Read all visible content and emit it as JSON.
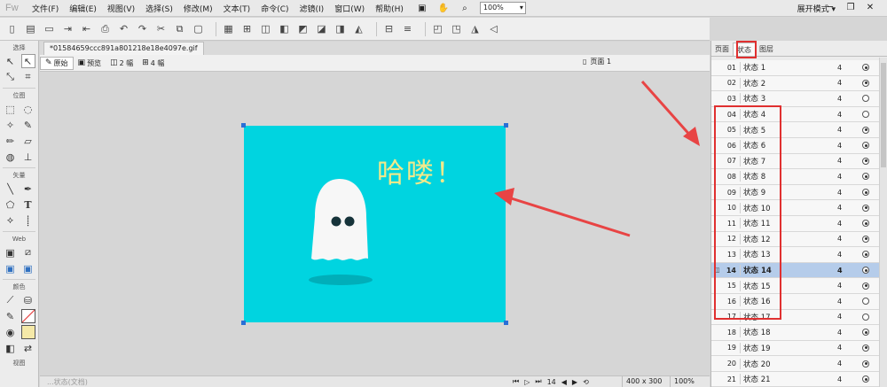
{
  "app": {
    "logo": "Fw"
  },
  "menu": [
    "文件(F)",
    "编辑(E)",
    "视图(V)",
    "选择(S)",
    "修改(M)",
    "文本(T)",
    "命令(C)",
    "滤镜(I)",
    "窗口(W)",
    "帮助(H)"
  ],
  "menubar": {
    "zoom_value": "100%",
    "workspace_label": "展开模式 ▾"
  },
  "tool_sections": [
    "选择",
    "位图",
    "矢量",
    "Web",
    "颜色",
    "视图"
  ],
  "document": {
    "tab_title": "*01584659ccc891a801218e18e4097e.gif",
    "view_buttons": [
      "原始",
      "预览",
      "2 幅",
      "4 幅"
    ],
    "page_label": "页面 1"
  },
  "canvas": {
    "text": "哈喽！",
    "bg_color": "#00d4e0",
    "text_color": "#f2e98a"
  },
  "statusbar": {
    "left_text": "...状态(文档)",
    "frame_number": "14",
    "dimensions": "400 x 300",
    "zoom": "100%"
  },
  "panel": {
    "tabs": [
      "页面",
      "状态",
      "图层"
    ],
    "states": [
      {
        "num": "01",
        "name": "状态 1",
        "delay": "4",
        "selected": false,
        "active": true
      },
      {
        "num": "02",
        "name": "状态 2",
        "delay": "4",
        "selected": false,
        "active": true
      },
      {
        "num": "03",
        "name": "状态 3",
        "delay": "4",
        "selected": false,
        "active": false
      },
      {
        "num": "04",
        "name": "状态 4",
        "delay": "4",
        "selected": false,
        "active": false
      },
      {
        "num": "05",
        "name": "状态 5",
        "delay": "4",
        "selected": false,
        "active": true
      },
      {
        "num": "06",
        "name": "状态 6",
        "delay": "4",
        "selected": false,
        "active": true
      },
      {
        "num": "07",
        "name": "状态 7",
        "delay": "4",
        "selected": false,
        "active": true
      },
      {
        "num": "08",
        "name": "状态 8",
        "delay": "4",
        "selected": false,
        "active": true
      },
      {
        "num": "09",
        "name": "状态 9",
        "delay": "4",
        "selected": false,
        "active": true
      },
      {
        "num": "10",
        "name": "状态 10",
        "delay": "4",
        "selected": false,
        "active": true
      },
      {
        "num": "11",
        "name": "状态 11",
        "delay": "4",
        "selected": false,
        "active": true
      },
      {
        "num": "12",
        "name": "状态 12",
        "delay": "4",
        "selected": false,
        "active": true
      },
      {
        "num": "13",
        "name": "状态 13",
        "delay": "4",
        "selected": false,
        "active": true
      },
      {
        "num": "14",
        "name": "状态 14",
        "delay": "4",
        "selected": true,
        "active": true
      },
      {
        "num": "15",
        "name": "状态 15",
        "delay": "4",
        "selected": false,
        "active": true
      },
      {
        "num": "16",
        "name": "状态 16",
        "delay": "4",
        "selected": false,
        "active": false
      },
      {
        "num": "17",
        "name": "状态 17",
        "delay": "4",
        "selected": false,
        "active": false
      },
      {
        "num": "18",
        "name": "状态 18",
        "delay": "4",
        "selected": false,
        "active": true
      },
      {
        "num": "19",
        "name": "状态 19",
        "delay": "4",
        "selected": false,
        "active": true
      },
      {
        "num": "20",
        "name": "状态 20",
        "delay": "4",
        "selected": false,
        "active": true
      },
      {
        "num": "21",
        "name": "状态 21",
        "delay": "4",
        "selected": false,
        "active": true
      }
    ]
  },
  "annotation": {
    "highlight_color": "#e03030"
  }
}
